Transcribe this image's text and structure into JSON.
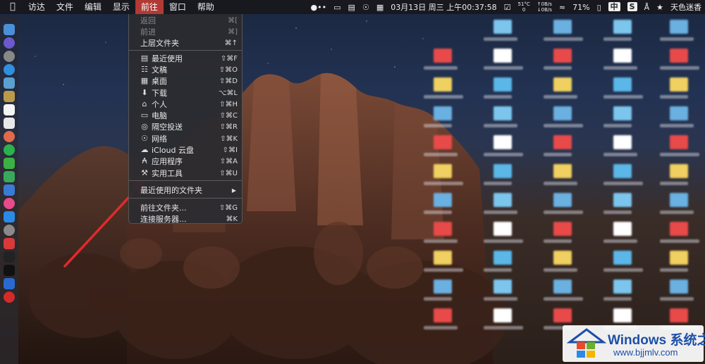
{
  "menubar": {
    "items": [
      "访达",
      "文件",
      "编辑",
      "显示",
      "前往",
      "窗口",
      "帮助"
    ],
    "active_index": 4,
    "status": {
      "date_time": "03月13日 周三 上午00:37:58",
      "temperature": "51°C",
      "temperature_sub": "0",
      "net_up": "0B/s",
      "net_down": "0B/s",
      "battery": "71%",
      "input_method": "中",
      "user": "天色迷香"
    }
  },
  "go_menu": {
    "items": [
      {
        "label": "返回",
        "shortcut": "⌘[",
        "icon": "",
        "disabled": true
      },
      {
        "label": "前进",
        "shortcut": "⌘]",
        "icon": "",
        "disabled": true
      },
      {
        "label": "上层文件夹",
        "shortcut": "⌘↑",
        "icon": "",
        "disabled": false
      },
      {
        "label": "最近使用",
        "shortcut": "⇧⌘F",
        "icon": "recents-icon",
        "disabled": false
      },
      {
        "label": "文稿",
        "shortcut": "⇧⌘O",
        "icon": "documents-icon",
        "disabled": false
      },
      {
        "label": "桌面",
        "shortcut": "⇧⌘D",
        "icon": "desktop-icon",
        "disabled": false
      },
      {
        "label": "下载",
        "shortcut": "⌥⌘L",
        "icon": "downloads-icon",
        "disabled": false
      },
      {
        "label": "个人",
        "shortcut": "⇧⌘H",
        "icon": "home-icon",
        "disabled": false
      },
      {
        "label": "电脑",
        "shortcut": "⇧⌘C",
        "icon": "computer-icon",
        "disabled": false
      },
      {
        "label": "隔空投送",
        "shortcut": "⇧⌘R",
        "icon": "airdrop-icon",
        "disabled": false
      },
      {
        "label": "网络",
        "shortcut": "⇧⌘K",
        "icon": "network-icon",
        "disabled": false
      },
      {
        "label": "iCloud 云盘",
        "shortcut": "⇧⌘I",
        "icon": "icloud-icon",
        "disabled": false
      },
      {
        "label": "应用程序",
        "shortcut": "⇧⌘A",
        "icon": "applications-icon",
        "disabled": false
      },
      {
        "label": "实用工具",
        "shortcut": "⇧⌘U",
        "icon": "utilities-icon",
        "disabled": false
      },
      {
        "label": "最近使用的文件夹",
        "shortcut": "▶",
        "icon": "",
        "disabled": false
      },
      {
        "label": "前往文件夹...",
        "shortcut": "⇧⌘G",
        "icon": "",
        "disabled": false
      },
      {
        "label": "连接服务器...",
        "shortcut": "⌘K",
        "icon": "",
        "disabled": false
      }
    ]
  },
  "watermark": {
    "title": "Windows 系统之家",
    "url": "www.bjjmlv.com"
  },
  "colors": {
    "menu_highlight": "#b13a35",
    "arrow": "#e02a2a",
    "watermark_text": "#1b4fa8"
  }
}
